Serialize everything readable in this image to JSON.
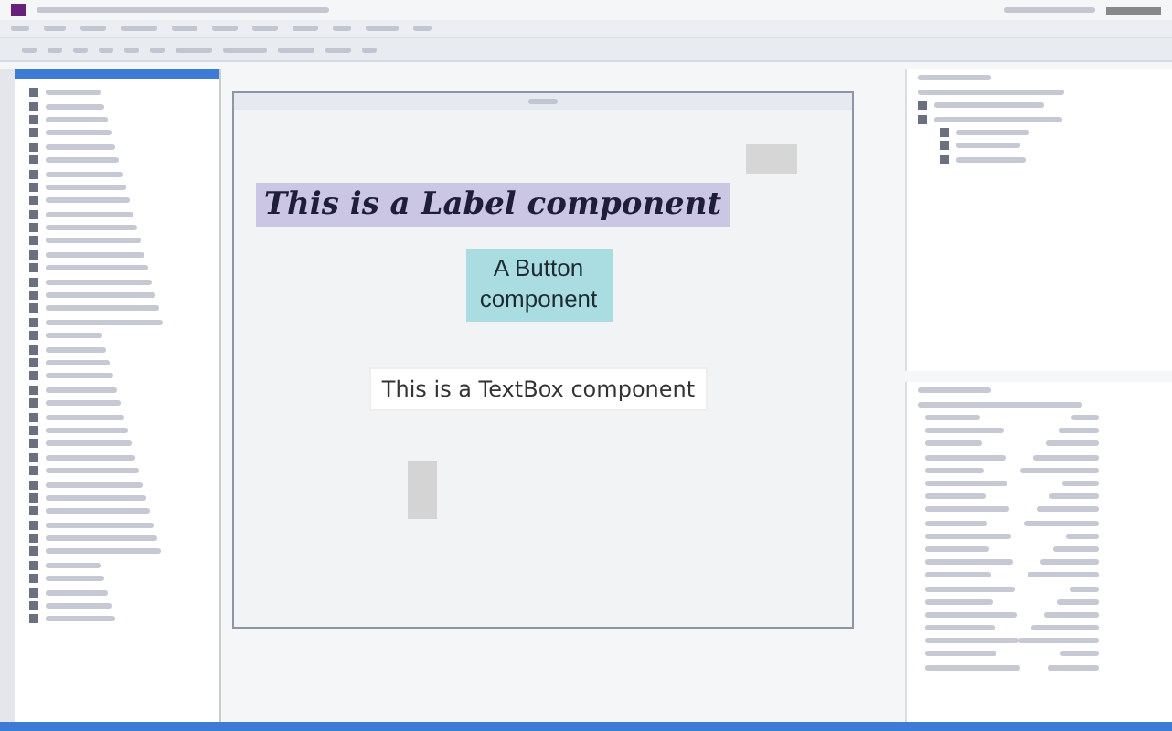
{
  "designer": {
    "form": {
      "label": "This is a Label component",
      "button": "A Button component",
      "textbox": "This is a TextBox component"
    }
  }
}
